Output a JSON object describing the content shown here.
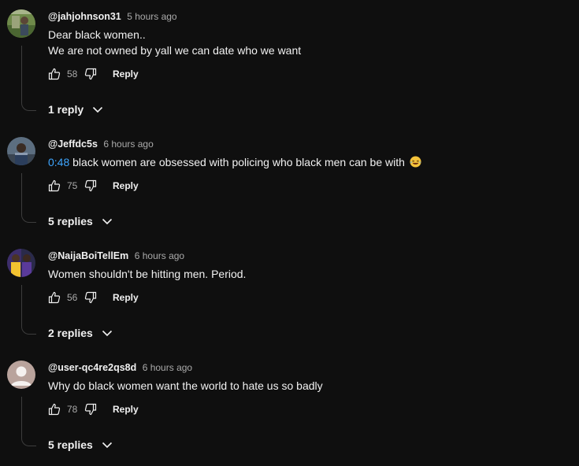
{
  "comments": [
    {
      "author": "@jahjohnson31",
      "time": "5 hours ago",
      "lines": [
        "Dear black women..",
        "We are not owned by yall we can date who we want"
      ],
      "likes": "58",
      "reply_label": "Reply",
      "replies_label": "1 reply"
    },
    {
      "author": "@Jeffdc5s",
      "time": "6 hours ago",
      "timestamp_link": "0:48",
      "text": " black women are obsessed with policing who black men can be with",
      "emoji": "laughing-emoji",
      "likes": "75",
      "reply_label": "Reply",
      "replies_label": "5 replies"
    },
    {
      "author": "@NaijaBoiTellEm",
      "time": "6 hours ago",
      "text": "Women shouldn't be hitting men. Period.",
      "likes": "56",
      "reply_label": "Reply",
      "replies_label": "2 replies"
    },
    {
      "author": "@user-qc4re2qs8d",
      "time": "6 hours ago",
      "text": "Why do black women want the world to hate us so badly",
      "likes": "78",
      "reply_label": "Reply",
      "replies_label": "5 replies"
    }
  ],
  "icons": {
    "like": "thumbs-up-icon",
    "dislike": "thumbs-down-icon",
    "expand": "chevron-down-icon"
  },
  "colors": {
    "background": "#0f0f0f",
    "text": "#f1f1f1",
    "secondary": "#aaaaaa",
    "link": "#3ea6ff",
    "thread_line": "#3d3d3d"
  }
}
